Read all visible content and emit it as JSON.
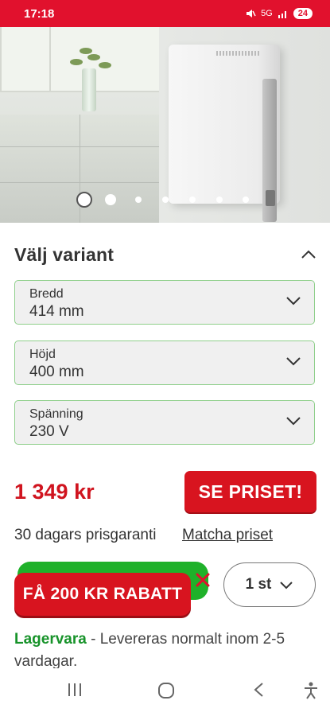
{
  "status_bar": {
    "time": "17:18",
    "network": "5G",
    "battery": "24"
  },
  "gallery": {
    "page_count": 7,
    "active_index": 0
  },
  "variant_section": {
    "title": "Välj variant",
    "fields": [
      {
        "label": "Bredd",
        "value": "414 mm"
      },
      {
        "label": "Höjd",
        "value": "400 mm"
      },
      {
        "label": "Spänning",
        "value": "230 V"
      }
    ]
  },
  "pricing": {
    "price": "1 349 kr",
    "cta_label": "SE PRISET!",
    "guarantee": "30 dagars prisgaranti",
    "match_link": "Matcha priset"
  },
  "promo": {
    "label": "FÅ 200 KR RABATT"
  },
  "quantity": {
    "label": "1 st"
  },
  "stock": {
    "status": "Lagervara",
    "delivery": " - Levereras normalt inom 2-5 vardagar."
  },
  "colors": {
    "brand_red": "#e1112d",
    "accent_green": "#1fb12a",
    "stock_green": "#17932a"
  }
}
